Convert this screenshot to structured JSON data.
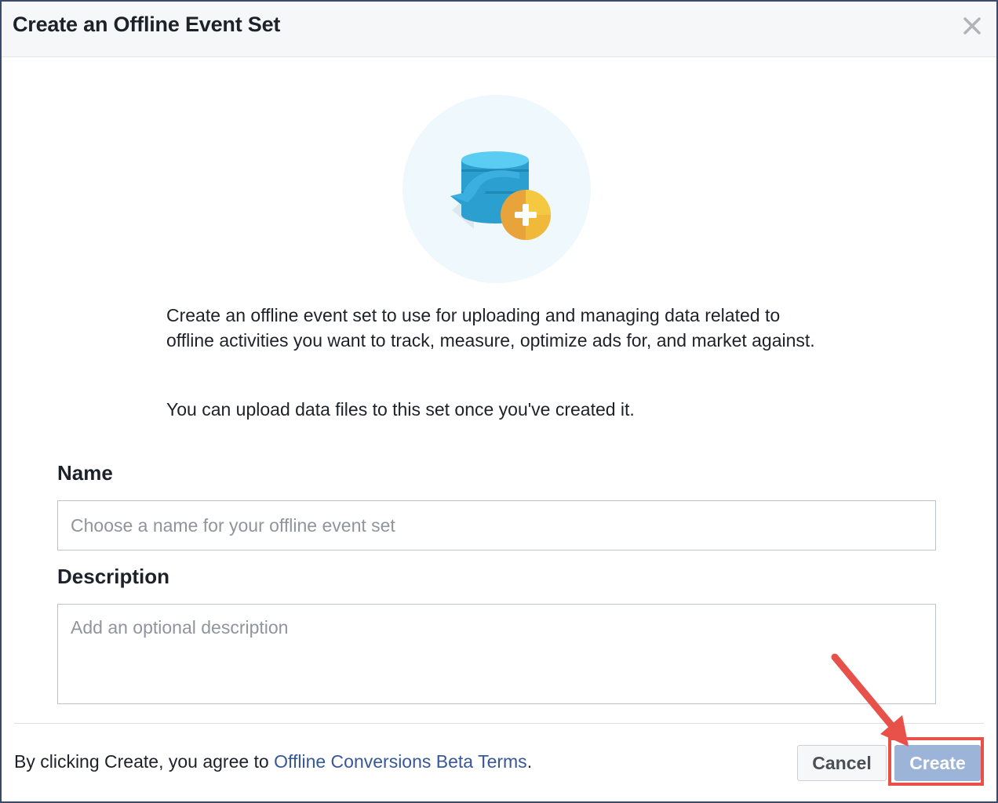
{
  "dialog": {
    "title": "Create an Offline Event Set"
  },
  "intro": {
    "paragraph1": "Create an offline event set to use for uploading and managing data related to offline activities you want to track, measure, optimize ads for, and market against.",
    "paragraph2": "You can upload data files to this set once you've created it."
  },
  "form": {
    "name_label": "Name",
    "name_placeholder": "Choose a name for your offline event set",
    "name_value": "",
    "description_label": "Description",
    "description_placeholder": "Add an optional description",
    "description_value": ""
  },
  "footer": {
    "terms_prefix": "By clicking Create, you agree to ",
    "terms_link": "Offline Conversions Beta Terms",
    "terms_suffix": ".",
    "cancel_label": "Cancel",
    "create_label": "Create"
  },
  "icons": {
    "close": "close-icon",
    "illustration": "database-add-icon",
    "annotation": "arrow-annotation-icon"
  },
  "colors": {
    "link": "#365899",
    "create_button": "#9cb4d8",
    "annotation": "#e8504a"
  }
}
